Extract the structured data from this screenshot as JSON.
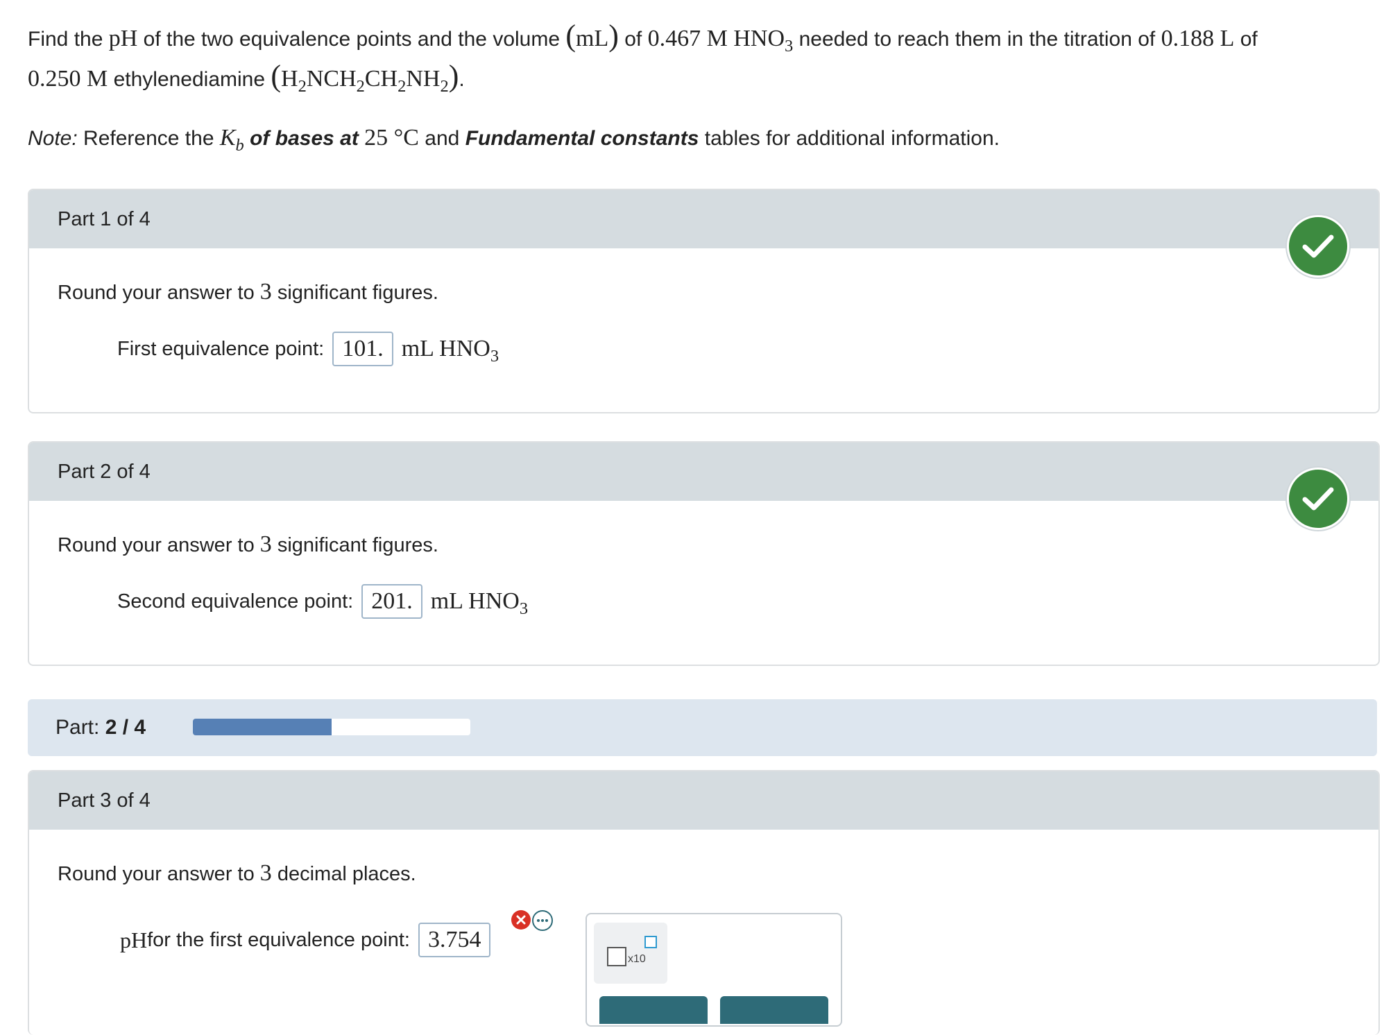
{
  "question": {
    "line1_a": "Find the ",
    "line1_pH": "pH",
    "line1_b": " of the two equivalence points and the volume ",
    "line1_mL": "mL",
    "line1_c": " of ",
    "line1_conc": "0.467 M HNO",
    "line1_conc_sub": "3",
    "line1_d": " needed to reach them in the titration of ",
    "line1_vol": "0.188 L",
    "line1_e": " of",
    "line2_conc": "0.250 M",
    "line2_name": " ethylenediamine ",
    "formula": {
      "p1": "H",
      "s1": "2",
      "p2": "NCH",
      "s2": "2",
      "p3": "CH",
      "s3": "2",
      "p4": "NH",
      "s4": "2"
    },
    "line2_end": "."
  },
  "note": {
    "label": "Note:",
    "a": " Reference the ",
    "K": "K",
    "K_sub": "b",
    "b": " of bases at ",
    "temp": "25 °C",
    "c": " and ",
    "d": "Fundamental constants",
    "e": " tables for additional information."
  },
  "parts": [
    {
      "header": "Part 1 of 4",
      "instr_a": "Round your answer to ",
      "instr_n": "3",
      "instr_b": " significant figures.",
      "answer_label": "First equivalence point:",
      "answer_value": "101.",
      "unit": "mL HNO",
      "unit_sub": "3",
      "status": "correct"
    },
    {
      "header": "Part 2 of 4",
      "instr_a": "Round your answer to ",
      "instr_n": "3",
      "instr_b": " significant figures.",
      "answer_label": "Second equivalence point:",
      "answer_value": "201.",
      "unit": "mL HNO",
      "unit_sub": "3",
      "status": "correct"
    },
    {
      "header": "Part 3 of 4",
      "instr_a": "Round your answer to ",
      "instr_n": "3",
      "instr_b": " decimal places.",
      "answer_label_pre": "pH",
      "answer_label": " for the first equivalence point:",
      "answer_value": "3.754",
      "status": "incorrect"
    }
  ],
  "progress": {
    "label": "Part:",
    "value": "2 / 4",
    "fraction": 0.5
  },
  "tools": {
    "sci_notation_label": "x10"
  },
  "colors": {
    "correct_green": "#3d8b40",
    "error_red": "#d93025",
    "progress_fill": "#5680b5",
    "header_gray": "#d5dce0",
    "progress_bg": "#dde6ef",
    "teal_button": "#2e6b78"
  }
}
